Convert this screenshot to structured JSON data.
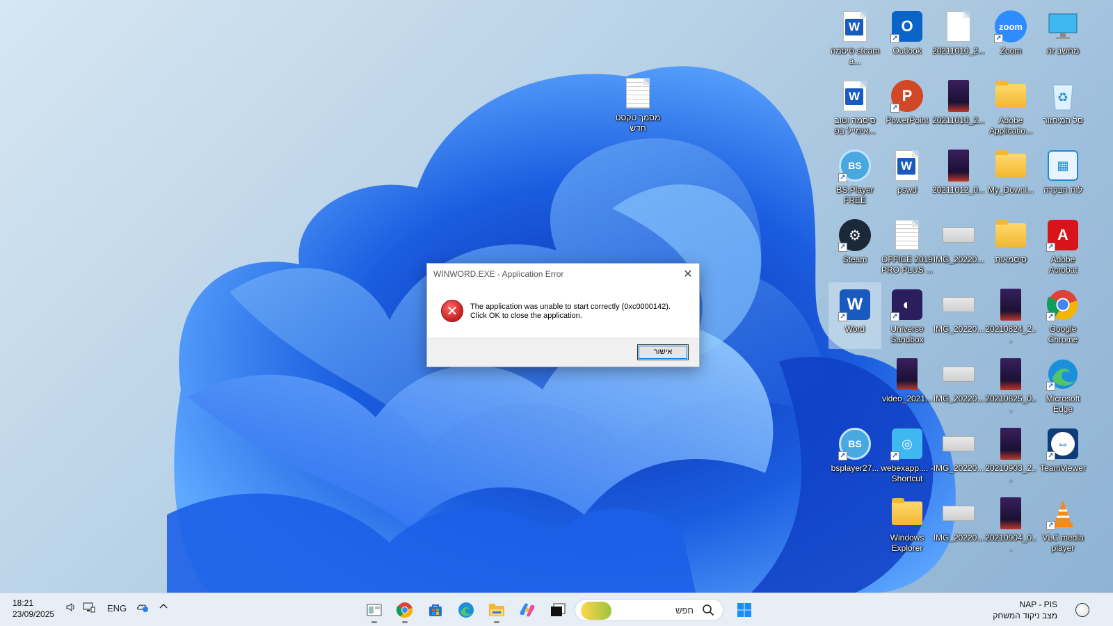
{
  "desktop": {
    "icons": [
      {
        "label": "מחשב זה",
        "icon": "monitor-icon"
      },
      {
        "label": "Zoom",
        "icon": "zoom-icon"
      },
      {
        "label": "20211010_2...",
        "icon": "blank-document-icon"
      },
      {
        "label": "Outlook",
        "icon": "outlook-icon"
      },
      {
        "label": "סיסמה steam a...",
        "icon": "word-document-icon"
      },
      {
        "label": "סל המיחזור",
        "icon": "recycle-bin-icon"
      },
      {
        "label": "Adobe Applicatio...",
        "icon": "folder-icon"
      },
      {
        "label": "20211010_2...",
        "icon": "video-thumbnail-icon"
      },
      {
        "label": "PowerPoint",
        "icon": "powerpoint-icon"
      },
      {
        "label": "סיסמה וטוב אימייל בפ...",
        "icon": "word-document-icon"
      },
      {
        "label": "לוח הבקרה",
        "icon": "control-panel-icon"
      },
      {
        "label": "My_Downl...",
        "icon": "folder-icon"
      },
      {
        "label": "20211012_0...",
        "icon": "video-thumbnail-icon"
      },
      {
        "label": "pswd",
        "icon": "word-document-icon"
      },
      {
        "label": "BS.Player FREE",
        "icon": "bsplayer-icon"
      },
      {
        "label": "Adobe Acrobat",
        "icon": "acrobat-icon"
      },
      {
        "label": "סיסמאות",
        "icon": "folder-icon"
      },
      {
        "label": "IMG_20220...",
        "icon": "image-thumbnail-icon"
      },
      {
        "label": "OFFICE 2019 PRO PLUS ...",
        "icon": "text-document-icon"
      },
      {
        "label": "Steam",
        "icon": "steam-icon"
      },
      {
        "label": "Google Chrome",
        "icon": "chrome-icon"
      },
      {
        "label": "20210824_2...",
        "icon": "video-thumbnail-icon"
      },
      {
        "label": "IMG_20220...",
        "icon": "image-thumbnail-icon"
      },
      {
        "label": "Universe Sandbox",
        "icon": "universe-sandbox-icon"
      },
      {
        "label": "Word",
        "icon": "word-icon"
      },
      {
        "label": "Microsoft Edge",
        "icon": "edge-icon"
      },
      {
        "label": "20210825_0...",
        "icon": "video-thumbnail-icon"
      },
      {
        "label": "IMG_20220...",
        "icon": "image-thumbnail-icon"
      },
      {
        "label": "video_2021...",
        "icon": "video-thumbnail-icon"
      },
      {
        "label": "TeamViewer",
        "icon": "teamviewer-icon"
      },
      {
        "label": "20210903_2...",
        "icon": "video-thumbnail-icon"
      },
      {
        "label": "IMG_20220...",
        "icon": "image-thumbnail-icon"
      },
      {
        "label": "webexapp.... - Shortcut",
        "icon": "webex-icon"
      },
      {
        "label": "bsplayer27...",
        "icon": "bsplayer-icon"
      },
      {
        "label": "VLC media player",
        "icon": "vlc-icon"
      },
      {
        "label": "20210904_0...",
        "icon": "video-thumbnail-icon"
      },
      {
        "label": "IMG_20220...",
        "icon": "image-thumbnail-icon"
      },
      {
        "label": "Windows Explorer",
        "icon": "folder-icon"
      },
      {
        "label": "מסמך טקסט חדש",
        "icon": "text-document-icon"
      }
    ]
  },
  "dialog": {
    "title": "WINWORD.EXE - Application Error",
    "message_line1": "The application was unable to start correctly (0xc0000142).",
    "message_line2": "Click OK to close the application.",
    "ok_label": "אישור",
    "icon": "error-icon"
  },
  "taskbar": {
    "time": "18:21",
    "date": "23/09/2025",
    "language": "ENG",
    "search_placeholder": "חפש",
    "weather_line1": "NAP - PIS",
    "weather_line2": "מצב ניקוד המשחק",
    "apps": [
      "task-view-icon",
      "chrome-icon",
      "store-icon",
      "edge-icon",
      "file-explorer-icon",
      "copilot-icon",
      "terminal-icon"
    ]
  },
  "colors": {
    "taskbar_bg": "#e8eef5",
    "word_blue": "#185abd",
    "error_red": "#c81e1e"
  }
}
